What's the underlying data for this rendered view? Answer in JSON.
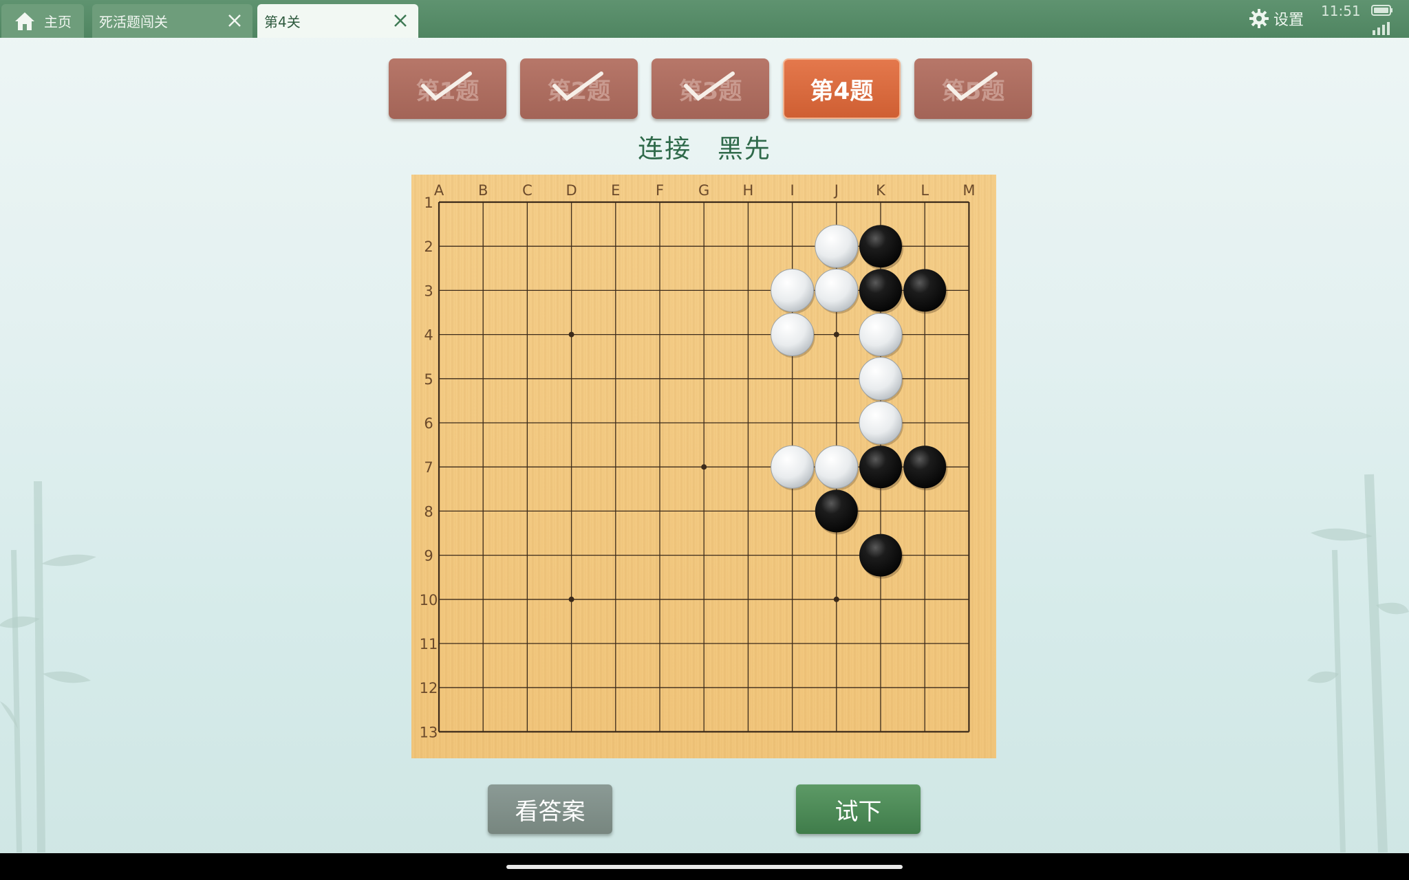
{
  "tabs": [
    {
      "label": "主页"
    },
    {
      "label": "死活题闯关"
    },
    {
      "label": "第4关"
    }
  ],
  "status": {
    "settings_label": "设置",
    "time": "11:51"
  },
  "questions": [
    {
      "label": "第1题",
      "solved": true
    },
    {
      "label": "第2题",
      "solved": true
    },
    {
      "label": "第3题",
      "solved": true
    },
    {
      "label": "第4题",
      "solved": false,
      "active": true
    },
    {
      "label": "第5题",
      "solved": true
    }
  ],
  "problem": {
    "type": "连接",
    "first": "黑先"
  },
  "board": {
    "size": 13,
    "col_labels": [
      "A",
      "B",
      "C",
      "D",
      "E",
      "F",
      "G",
      "H",
      "I",
      "J",
      "K",
      "L",
      "M"
    ],
    "row_labels": [
      "1",
      "2",
      "3",
      "4",
      "5",
      "6",
      "7",
      "8",
      "9",
      "10",
      "11",
      "12",
      "13"
    ],
    "star_points": [
      "D4",
      "J4",
      "G7",
      "D10",
      "J10"
    ],
    "black_stones": [
      "K2",
      "K3",
      "L3",
      "K7",
      "L7",
      "J8",
      "K9"
    ],
    "white_stones": [
      "J2",
      "I3",
      "J3",
      "I4",
      "K4",
      "K5",
      "K6",
      "I7",
      "J7"
    ]
  },
  "buttons": {
    "answer_label": "看答案",
    "try_label": "试下"
  }
}
